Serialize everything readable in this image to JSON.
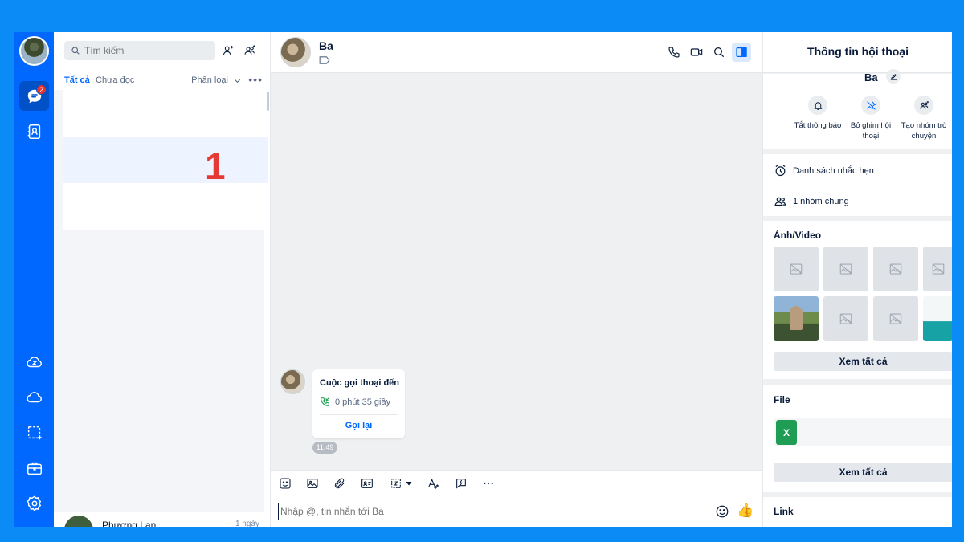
{
  "rail": {
    "badge_count": "2",
    "icons": [
      "chat-icon",
      "contacts-icon",
      "zcloud-icon",
      "cloud-icon",
      "screenshot-icon",
      "toolbox-icon",
      "settings-icon"
    ]
  },
  "list": {
    "search_placeholder": "Tìm kiếm",
    "tabs": [
      "Tất cả",
      "Chưa đọc"
    ],
    "classify_label": "Phân loại",
    "overlay_number": "1",
    "peek_name": "Phượng Lan",
    "peek_time": "1 ngày"
  },
  "chat": {
    "contact_name": "Ba",
    "call": {
      "title": "Cuộc gọi thoại đến",
      "duration": "0 phút 35 giây",
      "callback_label": "Gọi lại",
      "time": "11:49"
    },
    "composer_placeholder": "Nhập @, tin nhắn tới Ba"
  },
  "info": {
    "title": "Thông tin hội thoại",
    "contact_name": "Ba",
    "actions": [
      {
        "label": "Tắt thông báo",
        "icon": "bell-icon"
      },
      {
        "label": "Bỏ ghim hội thoại",
        "icon": "unpin-icon"
      },
      {
        "label": "Tạo nhóm trò chuyện",
        "icon": "add-group-icon"
      }
    ],
    "reminders_label": "Danh sách nhắc hẹn",
    "common_groups_label": "1 nhóm chung",
    "media_title": "Ảnh/Video",
    "media_see_all": "Xem tất cả",
    "file_title": "File",
    "file_icon_letter": "X",
    "file_see_all": "Xem tất cả",
    "link_title": "Link"
  },
  "colors": {
    "brand": "#0068ff",
    "background": "#0a8bf5",
    "badge": "#e5322d",
    "overlay_number": "#e53935"
  }
}
